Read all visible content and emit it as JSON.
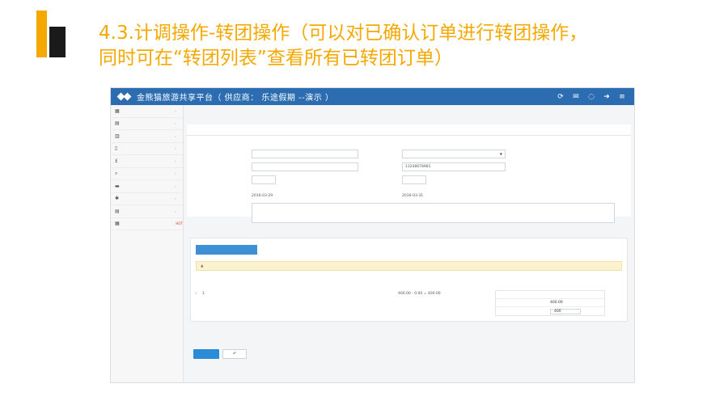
{
  "slide": {
    "title_line1": "4.3.计调操作-转团操作（可以对已确认订单进行转团操作，",
    "title_line2": "同时可在“转团列表”查看所有已转团订单）"
  },
  "app": {
    "brand": "金熊猫旅游共享平台（ 供应商： 乐途假期 --演示 ）",
    "breadcrumb": "",
    "top_icons": [
      "refresh-icon",
      "mail-icon",
      "chat-icon",
      "logout-icon",
      "menu-icon"
    ]
  },
  "sidebar": {
    "items": [
      {
        "icon": "▦",
        "label": "",
        "arrow": "‹",
        "hot": ""
      },
      {
        "icon": "▤",
        "label": "",
        "arrow": "‹",
        "hot": ""
      },
      {
        "icon": "▥",
        "label": "",
        "arrow": "‹",
        "hot": ""
      },
      {
        "icon": "▯",
        "label": "",
        "arrow": "‹",
        "hot": ""
      },
      {
        "icon": "£",
        "label": "",
        "arrow": "‹",
        "hot": ""
      },
      {
        "icon": "⌕",
        "label": "",
        "arrow": "‹",
        "hot": ""
      },
      {
        "icon": "▬",
        "label": "",
        "arrow": "‹",
        "hot": ""
      },
      {
        "icon": "✱",
        "label": "",
        "arrow": "‹",
        "hot": ""
      },
      {
        "icon": "▤",
        "label": "",
        "arrow": "‹",
        "hot": ""
      },
      {
        "icon": "▦",
        "label": "",
        "arrow": "",
        "hot": "HOT"
      }
    ]
  },
  "form": {
    "panel_title": "",
    "order_no_label": "",
    "order_no_value": "",
    "people_label": "",
    "people_value": "",
    "route_label": "",
    "route_value": "",
    "plan_label": "",
    "plan_value": "",
    "agency_label": "",
    "agency_value": "",
    "contact_label": "",
    "contact_value": "",
    "phone_label": "",
    "phone_value": "13248678981",
    "fee_label": "",
    "fee_hint": "",
    "cost_label": "",
    "cost_hint": "",
    "depart_label": "",
    "depart_value": "2016-03-29",
    "return_label": "",
    "return_value": "2016-03-31",
    "remark_label": "",
    "remark_value": ""
  },
  "orders": {
    "tab": "",
    "tip": "",
    "headers": {
      "col_no": "",
      "col_info_1": "",
      "col_info_2": "",
      "col_price": "",
      "col_price_detail": ""
    },
    "row": {
      "checked": "✓",
      "index": "1",
      "order_link": "",
      "people": "",
      "contact": "",
      "price_formula": "400.00 - 0.00 = 400.00",
      "price_table": [
        {
          "name": "",
          "value": ""
        },
        {
          "name": "",
          "value": "400.00"
        },
        {
          "name": "",
          "value": "400"
        }
      ]
    }
  },
  "buttons": {
    "save": "",
    "back": ""
  }
}
